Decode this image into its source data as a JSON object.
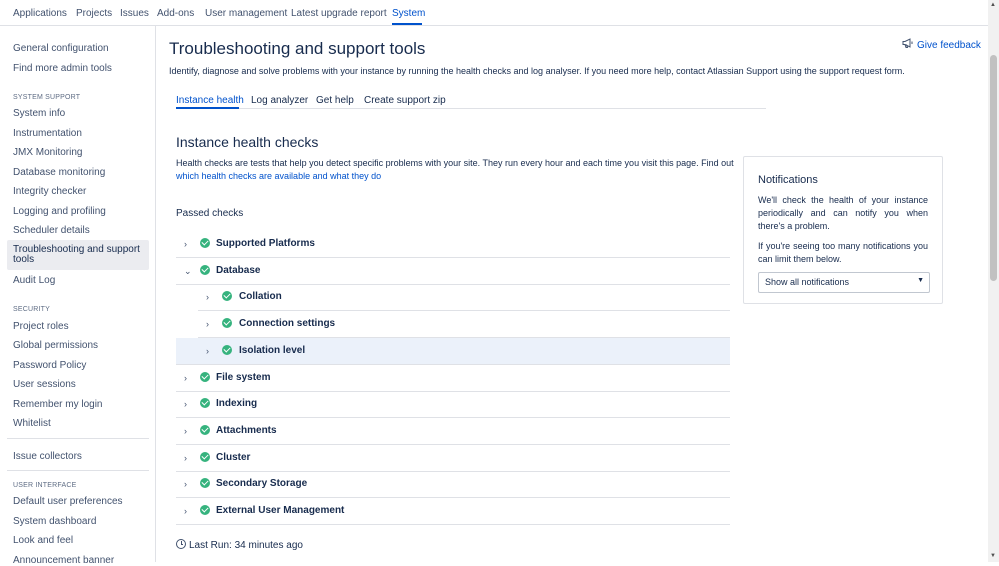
{
  "topnav": {
    "tabs": [
      {
        "label": "Applications"
      },
      {
        "label": "Projects"
      },
      {
        "label": "Issues"
      },
      {
        "label": "Add-ons"
      },
      {
        "label": "User management"
      },
      {
        "label": "Latest upgrade report"
      },
      {
        "label": "System",
        "active": true
      }
    ]
  },
  "sidebar": {
    "items": [
      "General configuration",
      "Find more admin tools"
    ],
    "system_support": {
      "heading": "SYSTEM SUPPORT",
      "items": [
        "System info",
        "Instrumentation",
        "JMX Monitoring",
        "Database monitoring",
        "Integrity checker",
        "Logging and profiling",
        "Scheduler details",
        "Troubleshooting and support tools",
        "Audit Log"
      ],
      "active_index": 7
    },
    "security": {
      "heading": "SECURITY",
      "items": [
        "Project roles",
        "Global permissions",
        "Password Policy",
        "User sessions",
        "Remember my login",
        "Whitelist"
      ]
    },
    "issue_collectors": "Issue collectors",
    "user_interface": {
      "heading": "USER INTERFACE",
      "items": [
        "Default user preferences",
        "System dashboard",
        "Look and feel",
        "Announcement banner"
      ]
    }
  },
  "main": {
    "title": "Troubleshooting and support tools",
    "description": "Identify, diagnose and solve problems with your instance by running the health checks and log analyser. If you need more help, contact Atlassian Support using the support request form.",
    "feedback_label": "Give feedback",
    "tabs": [
      {
        "label": "Instance health",
        "active": true
      },
      {
        "label": "Log analyzer"
      },
      {
        "label": "Get help"
      },
      {
        "label": "Create support zip"
      }
    ],
    "health_title": "Instance health checks",
    "health_desc_prefix": "Health checks are tests that help you detect specific problems with your site. They run every hour and each time you visit this page. Find out ",
    "health_desc_link": "which health checks are available and what they do",
    "passed_heading": "Passed checks",
    "checks": [
      {
        "label": "Supported Platforms",
        "expanded": false,
        "level": 0
      },
      {
        "label": "Database",
        "expanded": true,
        "level": 0
      },
      {
        "label": "Collation",
        "expanded": false,
        "level": 1
      },
      {
        "label": "Connection settings",
        "expanded": false,
        "level": 1
      },
      {
        "label": "Isolation level",
        "expanded": false,
        "level": 1,
        "highlighted": true
      },
      {
        "label": "File system",
        "expanded": false,
        "level": 0
      },
      {
        "label": "Indexing",
        "expanded": false,
        "level": 0
      },
      {
        "label": "Attachments",
        "expanded": false,
        "level": 0
      },
      {
        "label": "Cluster",
        "expanded": false,
        "level": 0
      },
      {
        "label": "Secondary Storage",
        "expanded": false,
        "level": 0
      },
      {
        "label": "External User Management",
        "expanded": false,
        "level": 0
      }
    ],
    "last_run": "Last Run: 34 minutes ago"
  },
  "notifications": {
    "title": "Notifications",
    "p1": "We'll check the health of your instance periodically and can notify you when there's a problem.",
    "p2": "If you're seeing too many notifications you can limit them below.",
    "select_value": "Show all notifications"
  },
  "colors": {
    "accent": "#0052cc",
    "success": "#36b37e",
    "highlight_row": "#ebf1fa",
    "sidebar_active": "#ebecf0"
  }
}
